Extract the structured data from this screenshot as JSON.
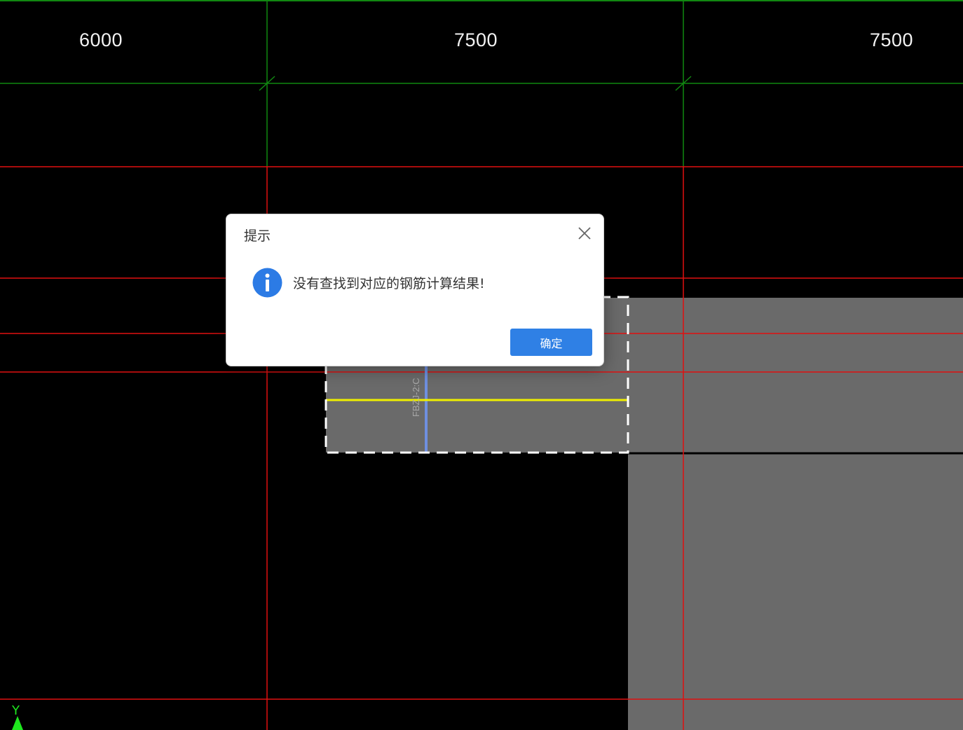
{
  "canvas": {
    "dimensions": [
      "6000",
      "7500",
      "7500"
    ],
    "component_label": "FBZJ-2:C",
    "axis_label": "Y"
  },
  "colors": {
    "background": "#000000",
    "grid_red": "#e01010",
    "grid_green": "#118811",
    "slab_gray": "#6a6a6a",
    "beam_yellow": "#f0f000",
    "beam_blue": "#6f8fe0",
    "primary_button": "#2f80e5",
    "info_icon": "#2c7be5"
  },
  "dialog": {
    "title": "提示",
    "message": "没有查找到对应的钢筋计算结果!",
    "ok_label": "确定",
    "icon": "info-icon",
    "close_icon": "close-icon"
  }
}
